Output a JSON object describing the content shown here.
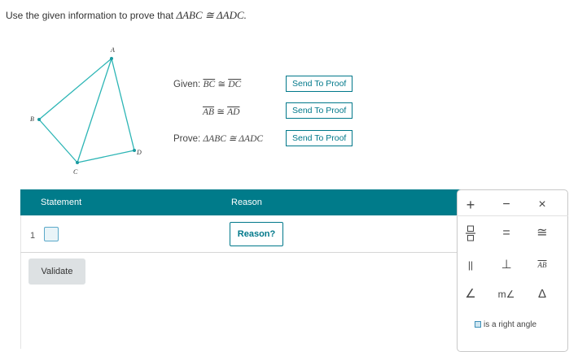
{
  "prompt": {
    "text": "Use the given information to prove that",
    "statement": "ΔABC ≅ ΔADC."
  },
  "figure": {
    "labels": {
      "a": "A",
      "b": "B",
      "c": "C",
      "d": "D"
    }
  },
  "given": {
    "label": "Given:",
    "items": [
      {
        "left": "BC",
        "op": "≅",
        "right": "DC"
      },
      {
        "left": "AB",
        "op": "≅",
        "right": "AD"
      }
    ],
    "prove_label": "Prove:",
    "prove": "ΔABC ≅ ΔADC",
    "send_label": "Send To Proof"
  },
  "table": {
    "col_statement": "Statement",
    "col_reason": "Reason",
    "rows": [
      {
        "num": "1",
        "reason_label": "Reason?"
      }
    ],
    "validate_label": "Validate"
  },
  "palette": {
    "row1": [
      "+",
      "−",
      "×"
    ],
    "row2": [
      "□/□",
      "=",
      "≅"
    ],
    "row3": [
      "||",
      "⊥",
      "AB"
    ],
    "row4": [
      "∠",
      "m∠",
      "Δ"
    ],
    "right_angle_label": "is a right angle"
  },
  "colors": {
    "accent": "#007b8a",
    "figure_line": "#2cb5b5"
  }
}
